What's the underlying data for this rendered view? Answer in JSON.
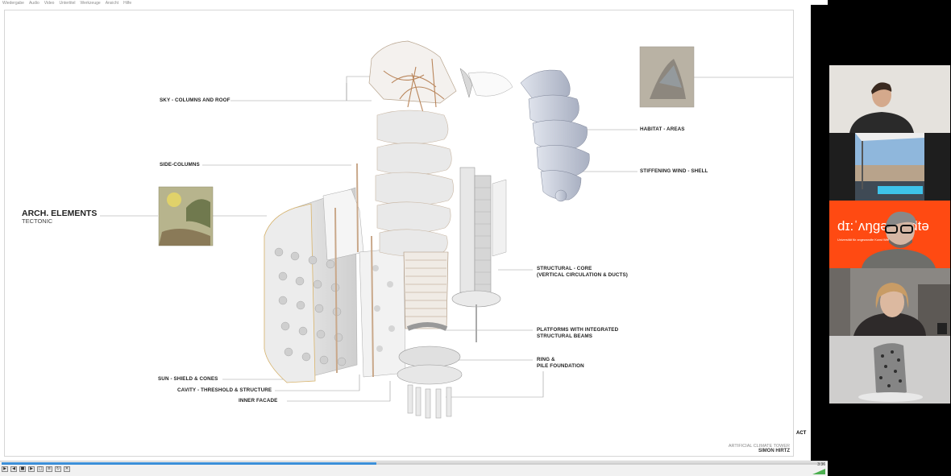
{
  "player": {
    "menu": [
      "Wiedergabe",
      "Audio",
      "Video",
      "Untertitel",
      "Werkzeuge",
      "Ansicht",
      "Hilfe"
    ],
    "time": "3:36",
    "progress": 0.455
  },
  "slide": {
    "title": "ARCH. ELEMENTS",
    "subtitle": "TECTONIC",
    "labels": {
      "sky": "SKY - COLUMNS AND ROOF",
      "side_columns": "SIDE-COLUMNS",
      "habitat": "HABITAT - AREAS",
      "stiffening": "STIFFENING WIND - SHELL",
      "structural_core_1": "STRUCTURAL - CORE",
      "structural_core_2": "(VERTICAL CIRCULATION & DUCTS)",
      "platforms_1": "PLATFORMS WITH INTEGRATED",
      "platforms_2": "STRUCTURAL BEAMS",
      "ring_1": "RING &",
      "ring_2": "PILE FOUNDATION",
      "sun_shield": "SUN - SHIELD & CONES",
      "cavity": "CAVITY - THRESHOLD & STRUCTURE",
      "inner_facade": "INNER FACADE"
    },
    "title_block": {
      "project": "ARTIFICIAL CLIMATE TOWER",
      "name": "SIMON HIRTZ"
    },
    "act": "ACT"
  },
  "participants": {
    "tile3_logo": "dɪ:ˈʌŋɡəvandtə",
    "tile3_small": "Universität für angewandte Kunst Wien"
  },
  "colors": {
    "accent_orange": "#ff4a12",
    "progress_blue": "#3c8fd9"
  }
}
